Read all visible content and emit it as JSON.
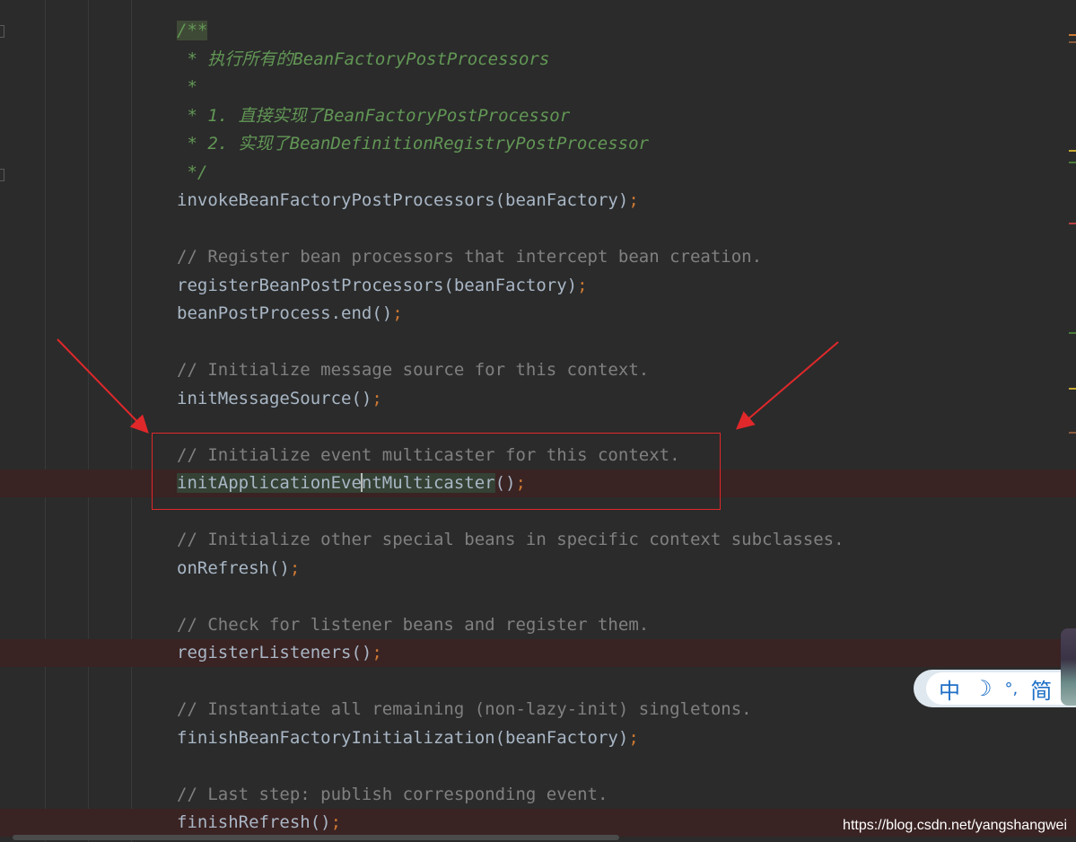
{
  "editor": {
    "lines": [
      {
        "kind": "doc",
        "text": "/**",
        "doc_start": true
      },
      {
        "kind": "doc",
        "text": " * 执行所有的BeanFactoryPostProcessors"
      },
      {
        "kind": "doc",
        "text": " *"
      },
      {
        "kind": "doc",
        "text": " * 1. 直接实现了BeanFactoryPostProcessor"
      },
      {
        "kind": "doc",
        "text": " * 2. 实现了BeanDefinitionRegistryPostProcessor"
      },
      {
        "kind": "doc",
        "text": " */"
      },
      {
        "kind": "call",
        "text": "invokeBeanFactoryPostProcessors(beanFactory)",
        "semi": ";"
      },
      {
        "kind": "blank",
        "text": ""
      },
      {
        "kind": "comment",
        "text": "// Register bean processors that intercept bean creation."
      },
      {
        "kind": "call",
        "text": "registerBeanPostProcessors(beanFactory)",
        "semi": ";"
      },
      {
        "kind": "call",
        "text": "beanPostProcess.end()",
        "semi": ";"
      },
      {
        "kind": "blank",
        "text": ""
      },
      {
        "kind": "comment",
        "text": "// Initialize message source for this context."
      },
      {
        "kind": "call",
        "text": "initMessageSource()",
        "semi": ";"
      },
      {
        "kind": "blank",
        "text": ""
      },
      {
        "kind": "comment",
        "text": "// Initialize event multicaster for this context."
      },
      {
        "kind": "call-caret",
        "before": "initApplicationEve",
        "after": "ntMulticaster",
        "rest": "()",
        "semi": ";",
        "breakpoint": true
      },
      {
        "kind": "blank",
        "text": ""
      },
      {
        "kind": "comment",
        "text": "// Initialize other special beans in specific context subclasses."
      },
      {
        "kind": "call",
        "text": "onRefresh()",
        "semi": ";"
      },
      {
        "kind": "blank",
        "text": ""
      },
      {
        "kind": "comment",
        "text": "// Check for listener beans and register them."
      },
      {
        "kind": "call",
        "text": "registerListeners()",
        "semi": ";",
        "breakpoint": true
      },
      {
        "kind": "blank",
        "text": ""
      },
      {
        "kind": "comment",
        "text": "// Instantiate all remaining (non-lazy-init) singletons."
      },
      {
        "kind": "call",
        "text": "finishBeanFactoryInitialization(beanFactory)",
        "semi": ";"
      },
      {
        "kind": "blank",
        "text": ""
      },
      {
        "kind": "comment",
        "text": "// Last step: publish corresponding event."
      },
      {
        "kind": "call",
        "text": "finishRefresh()",
        "semi": ";",
        "breakpoint": true
      }
    ]
  },
  "ime": {
    "mode_label": "中",
    "moon_icon": "crescent-moon-icon",
    "moon_glyph": "☽",
    "punct_label": "°,",
    "simplified_label": "简"
  },
  "watermark": "https://blog.csdn.net/yangshangwei",
  "colors": {
    "background": "#2b2b2b",
    "doc_comment": "#629755",
    "line_comment": "#808080",
    "identifier": "#a9b7c6",
    "semicolon": "#cc7832",
    "annotation_red": "#e0282b",
    "breakpoint_line": "#3a2323"
  }
}
